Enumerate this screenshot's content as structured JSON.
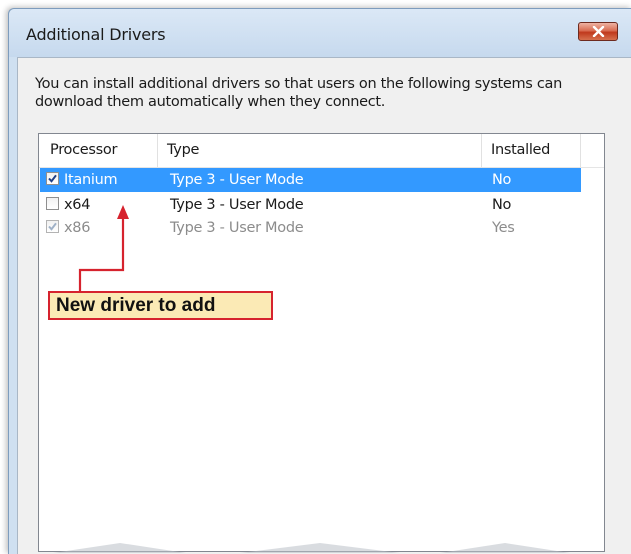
{
  "window": {
    "title": "Additional Drivers",
    "close_icon": "close-x-icon"
  },
  "description": "You can install additional drivers so that users on the following systems can download them automatically when they connect.",
  "list": {
    "columns": [
      "Processor",
      "Type",
      "Installed"
    ],
    "rows": [
      {
        "processor": "Itanium",
        "type": "Type 3 - User Mode",
        "installed": "No",
        "checked": true,
        "selected": true,
        "disabled": false
      },
      {
        "processor": "x64",
        "type": "Type 3 - User Mode",
        "installed": "No",
        "checked": false,
        "selected": false,
        "disabled": false
      },
      {
        "processor": "x86",
        "type": "Type 3 - User Mode",
        "installed": "Yes",
        "checked": true,
        "selected": false,
        "disabled": true
      }
    ]
  },
  "callout": {
    "text": "New driver to add",
    "border_color": "#d6232e",
    "fill_color": "#fbeab5"
  },
  "colors": {
    "selection": "#3399ff",
    "title_bar": "#c6d9ee",
    "close_button": "#c0391d"
  }
}
